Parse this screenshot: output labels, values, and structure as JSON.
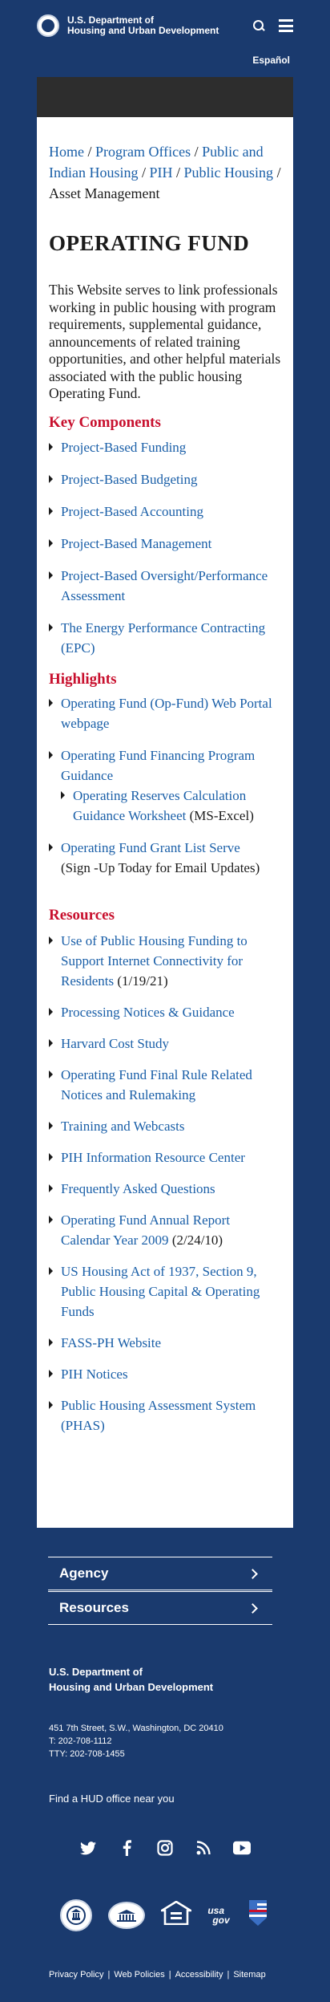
{
  "header": {
    "agency_line1": "U.S. Department of",
    "agency_line2": "Housing and Urban Development",
    "language_link": "Español"
  },
  "breadcrumb": {
    "home": "Home",
    "program_offices": "Program Offices",
    "pih": "Public and Indian Housing",
    "pih_short": "PIH",
    "public_housing": "Public Housing",
    "current": "Asset Management",
    "separator": "/"
  },
  "page": {
    "title": "OPERATING FUND",
    "intro": "This Website serves to link professionals working in public housing with program requirements, supplemental guidance, announcements of related training opportunities, and other helpful materials associated with the public housing Operating Fund."
  },
  "key_components": {
    "title": "Key Components",
    "items": [
      "Project-Based Funding",
      "Project-Based Budgeting",
      "Project-Based Accounting",
      "Project-Based Management",
      "Project-Based Oversight/Performance Assessment",
      "The Energy Performance Contracting (EPC)"
    ]
  },
  "highlights": {
    "title": "Highlights",
    "item1": "Operating Fund (Op-Fund) Web Portal webpage",
    "item2": "Operating Fund Financing Program Guidance",
    "item2_sub_link": "Operating Reserves Calculation Guidance Worksheet",
    "item2_sub_note": "(MS-Excel)",
    "item3_link": "Operating Fund Grant List Serve",
    "item3_note": "(Sign -Up Today for Email Updates)"
  },
  "resources": {
    "title": "Resources",
    "r1_link": "Use of Public Housing Funding to Support Internet Connectivity for Residents",
    "r1_note": "(1/19/21)",
    "r2": "Processing Notices & Guidance",
    "r3": "Harvard Cost Study",
    "r4": "Operating Fund Final Rule Related Notices and Rulemaking",
    "r5": "Training and Webcasts",
    "r6": "PIH Information Resource Center",
    "r7": "Frequently Asked Questions",
    "r8_link": "Operating Fund Annual Report Calendar Year 2009",
    "r8_note": "(2/24/10)",
    "r9": "US Housing Act of 1937, Section 9, Public Housing Capital & Operating Funds",
    "r10": "FASS-PH Website",
    "r11": "PIH Notices",
    "r12": "Public Housing Assessment System (PHAS)"
  },
  "footer": {
    "accordion_agency": "Agency",
    "accordion_resources": "Resources",
    "agency_line1": "U.S. Department of",
    "agency_line2": "Housing and Urban Development",
    "address": "451 7th Street, S.W., Washington, DC 20410",
    "phone": "T: 202-708-1112",
    "tty": "TTY: 202-708-1455",
    "find_office": "Find a HUD office near you",
    "usagov_line1": "usa",
    "usagov_line2": "gov",
    "links": [
      "Privacy Policy",
      "Web Policies",
      "Accessibility",
      "Sitemap"
    ],
    "link_separator": "|"
  },
  "icons": {
    "header": [
      "seal-icon",
      "search-icon",
      "menu-icon"
    ],
    "social": [
      "twitter-icon",
      "facebook-icon",
      "instagram-icon",
      "rss-icon",
      "youtube-icon"
    ],
    "logos": [
      "oig-seal-icon",
      "white-house-icon",
      "equal-housing-icon",
      "usagov-logo",
      "flag-icon"
    ]
  },
  "colors": {
    "brand_navy": "#1a3a6e",
    "link_blue": "#1a5fa8",
    "section_red": "#c8102e",
    "band_dark": "#2d2d2d"
  }
}
